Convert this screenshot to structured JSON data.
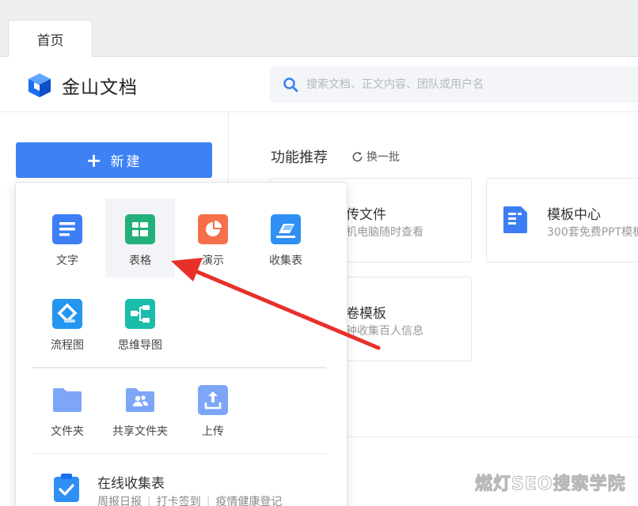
{
  "tabs": [
    {
      "label": "首页"
    }
  ],
  "header": {
    "brand": "金山文档",
    "search_placeholder": "搜索文档、正文内容、团队或用户名"
  },
  "sidebar": {
    "new_label": "新建"
  },
  "main": {
    "section_title": "功能推荐",
    "refresh_label": "换一批",
    "cards": [
      {
        "title": "传文件",
        "subtitle": "机电脑随时查看"
      },
      {
        "title": "模板中心",
        "subtitle": "300套免费PPT模板"
      },
      {
        "title": "卷模板",
        "subtitle": "钟收集百人信息"
      }
    ]
  },
  "dropdown": {
    "create_items": [
      {
        "label": "文字",
        "icon": "doc-icon",
        "color": "#3d7ef5"
      },
      {
        "label": "表格",
        "icon": "sheet-icon",
        "color": "#24b07a"
      },
      {
        "label": "演示",
        "icon": "ppt-icon",
        "color": "#f5704a"
      },
      {
        "label": "收集表",
        "icon": "form-icon",
        "color": "#2f8ff5"
      },
      {
        "label": "流程图",
        "icon": "flowchart-icon",
        "color": "#2396f0"
      },
      {
        "label": "思维导图",
        "icon": "mindmap-icon",
        "color": "#19bda9"
      }
    ],
    "file_items": [
      {
        "label": "文件夹",
        "icon": "folder-icon",
        "color": "#7ea6f7"
      },
      {
        "label": "共享文件夹",
        "icon": "shared-folder-icon",
        "color": "#7ea6f7"
      },
      {
        "label": "上传",
        "icon": "upload-icon",
        "color": "#7ea6f7"
      }
    ],
    "collect": {
      "title": "在线收集表",
      "tags": [
        "周报日报",
        "打卡签到",
        "疫情健康登记"
      ]
    }
  },
  "watermark": "燃灯SEO搜索学院",
  "colors": {
    "accent": "#3d81f5",
    "arrow": "#e8302a"
  }
}
